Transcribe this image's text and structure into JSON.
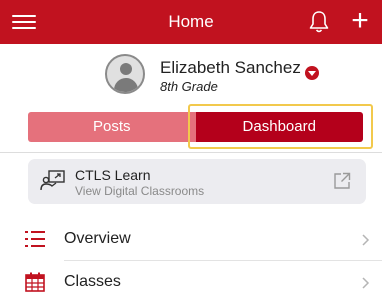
{
  "header": {
    "title": "Home",
    "menu_icon": "hamburger-menu-icon",
    "bell_icon": "bell-icon",
    "plus_symbol": "+"
  },
  "profile": {
    "name": "Elizabeth Sanchez",
    "grade": "8th Grade",
    "avatar_icon": "person-avatar-icon",
    "dropdown_icon": "caret-down-icon"
  },
  "tabs": [
    {
      "label": "Posts",
      "selected": false
    },
    {
      "label": "Dashboard",
      "selected": true
    }
  ],
  "card": {
    "title": "CTLS Learn",
    "subtitle": "View Digital Classrooms",
    "icon": "classroom-icon",
    "action_icon": "external-link-icon"
  },
  "menu": [
    {
      "label": "Overview",
      "icon": "list-icon"
    },
    {
      "label": "Classes",
      "icon": "calendar-icon"
    }
  ],
  "colors": {
    "brand_red": "#c1121f",
    "tab_inactive": "#e5717c",
    "tab_active": "#b4001b",
    "highlight": "#f2c94c",
    "card_bg": "#ececf0"
  }
}
